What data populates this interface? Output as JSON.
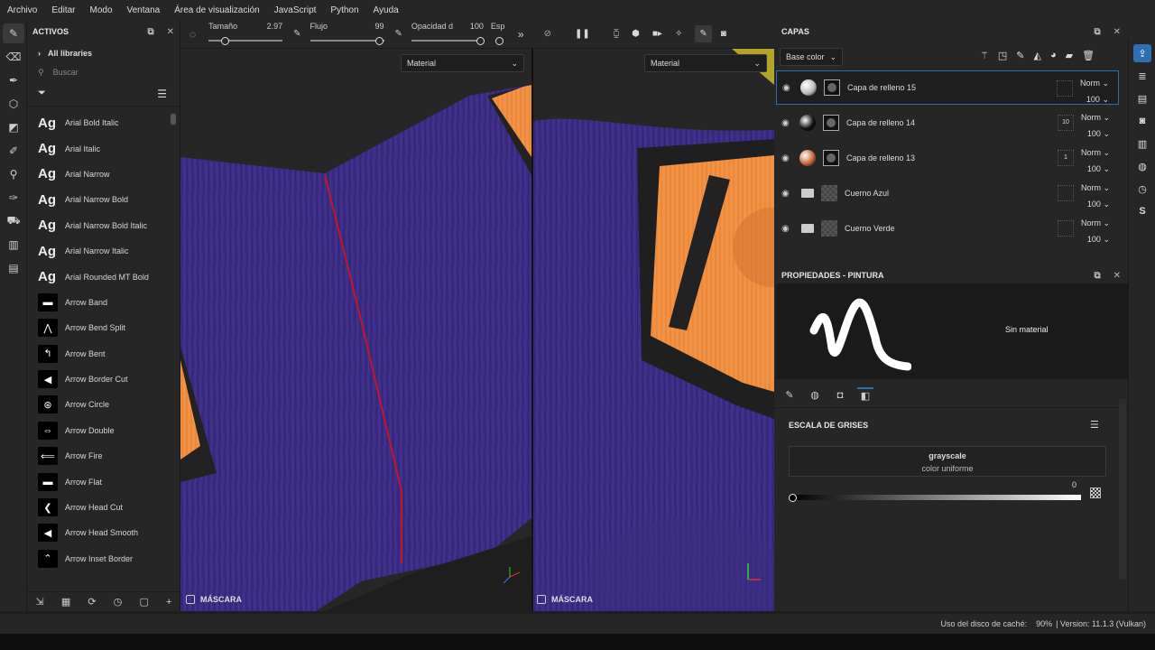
{
  "menu": [
    "Archivo",
    "Editar",
    "Modo",
    "Ventana",
    "Área de visualización",
    "JavaScript",
    "Python",
    "Ayuda"
  ],
  "assets": {
    "title": "ACTIVOS",
    "library": "All libraries",
    "search_placeholder": "Buscar",
    "items": [
      {
        "icon": "Ag",
        "label": "Arial Bold Italic"
      },
      {
        "icon": "Ag",
        "label": "Arial Italic"
      },
      {
        "icon": "Ag",
        "label": "Arial Narrow"
      },
      {
        "icon": "Ag",
        "label": "Arial Narrow Bold"
      },
      {
        "icon": "Ag",
        "label": "Arial Narrow Bold Italic"
      },
      {
        "icon": "Ag",
        "label": "Arial Narrow Italic"
      },
      {
        "icon": "Ag",
        "label": "Arial Rounded MT Bold"
      },
      {
        "icon": "arrow-band-icon",
        "label": "Arrow Band"
      },
      {
        "icon": "arrow-bend-split-icon",
        "label": "Arrow Bend Split"
      },
      {
        "icon": "arrow-bent-icon",
        "label": "Arrow Bent"
      },
      {
        "icon": "arrow-border-cut-icon",
        "label": "Arrow Border Cut"
      },
      {
        "icon": "arrow-circle-icon",
        "label": "Arrow Circle"
      },
      {
        "icon": "arrow-double-icon",
        "label": "Arrow Double"
      },
      {
        "icon": "arrow-fire-icon",
        "label": "Arrow Fire"
      },
      {
        "icon": "arrow-flat-icon",
        "label": "Arrow Flat"
      },
      {
        "icon": "arrow-head-cut-icon",
        "label": "Arrow Head Cut"
      },
      {
        "icon": "arrow-head-smooth-icon",
        "label": "Arrow Head Smooth"
      },
      {
        "icon": "arrow-inset-border-icon",
        "label": "Arrow Inset Border"
      }
    ]
  },
  "toolbar": {
    "size_label": "Tamaño",
    "size_value": "2.97",
    "flow_label": "Flujo",
    "flow_value": "99",
    "opacity_label": "Opacidad d",
    "opacity_value": "100",
    "spacing_label": "Esp"
  },
  "viewport": {
    "left_material": "Material",
    "right_material": "Material",
    "mask_label": "MÁSCARA"
  },
  "layers": {
    "title": "CAPAS",
    "channel": "Base color",
    "rows": [
      {
        "name": "Capa de relleno 15",
        "blend": "Norm",
        "opacity": "100",
        "thumb": "#bdbdbd",
        "selected": true,
        "type": "fill",
        "badge": ""
      },
      {
        "name": "Capa de relleno 14",
        "blend": "Norm",
        "opacity": "100",
        "thumb": "#111111",
        "selected": false,
        "type": "fill",
        "badge": "10"
      },
      {
        "name": "Capa de relleno 13",
        "blend": "Norm",
        "opacity": "100",
        "thumb": "#c8673a",
        "selected": false,
        "type": "fill",
        "badge": "1"
      },
      {
        "name": "Cuerno Azul",
        "blend": "Norm",
        "opacity": "100",
        "selected": false,
        "type": "folder",
        "badge": ""
      },
      {
        "name": "Cuerno Verde",
        "blend": "Norm",
        "opacity": "100",
        "selected": false,
        "type": "folder",
        "badge": ""
      }
    ]
  },
  "properties": {
    "title": "PROPIEDADES - PINTURA",
    "no_material": "Sin material",
    "section": "ESCALA DE GRISES",
    "card_title": "grayscale",
    "card_sub": "color uniforme",
    "value": "0"
  },
  "status": {
    "cache_label": "Uso del disco de caché:",
    "cache_value": "90%",
    "version": "| Version: 11.1.3 (Vulkan)"
  },
  "colors": {
    "accent": "#2f6fb0",
    "purple": "#3f2e86",
    "orange": "#f28a3e"
  }
}
